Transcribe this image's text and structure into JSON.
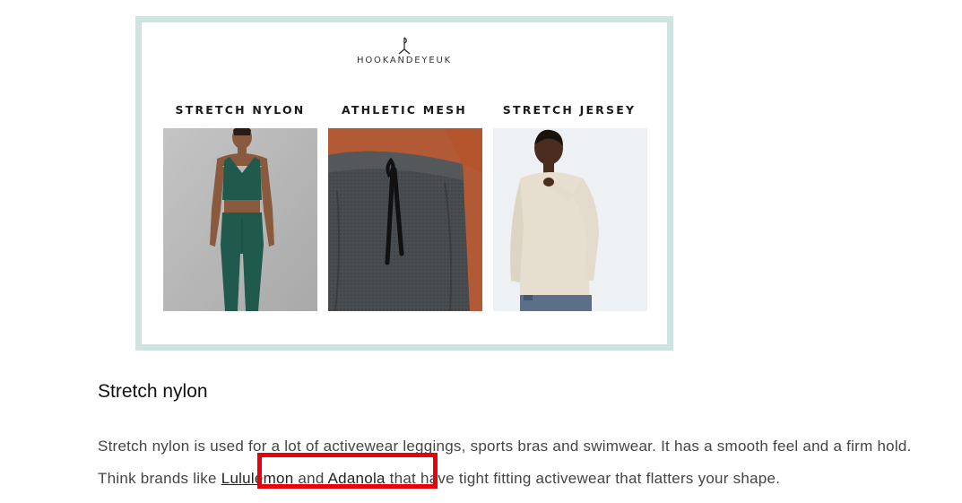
{
  "image": {
    "logo_text": "HOOKANDEYEUK",
    "columns": [
      {
        "label": "STRETCH NYLON"
      },
      {
        "label": "ATHLETIC MESH"
      },
      {
        "label": "STRETCH JERSEY"
      }
    ]
  },
  "article": {
    "heading": "Stretch nylon",
    "paragraph": {
      "text_1": "Stretch nylon is used for a lot of activewear leggings, sports bras and swimwear. It has a smooth feel and a firm hold. Think brands like ",
      "link_1": "Lululemon",
      "text_2": " and ",
      "link_2": "Adanola",
      "text_3": " that have tight fitting activewear that flatters your shape."
    }
  },
  "colors": {
    "frame_border": "#cfe3e1",
    "highlight": "#e8000b",
    "legging_green": "#1f5a4d"
  }
}
